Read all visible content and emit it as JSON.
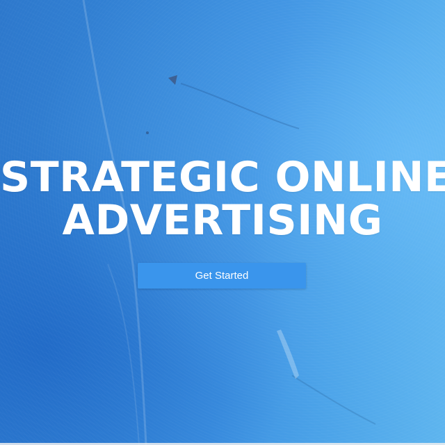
{
  "hero": {
    "headline_line1": "STRATEGIC ONLINE",
    "headline_line2": "ADVERTISING",
    "cta_label": "Get Started",
    "background_color": "#3586d8",
    "cta_color": "#3a95ec",
    "text_color": "#ffffff"
  }
}
